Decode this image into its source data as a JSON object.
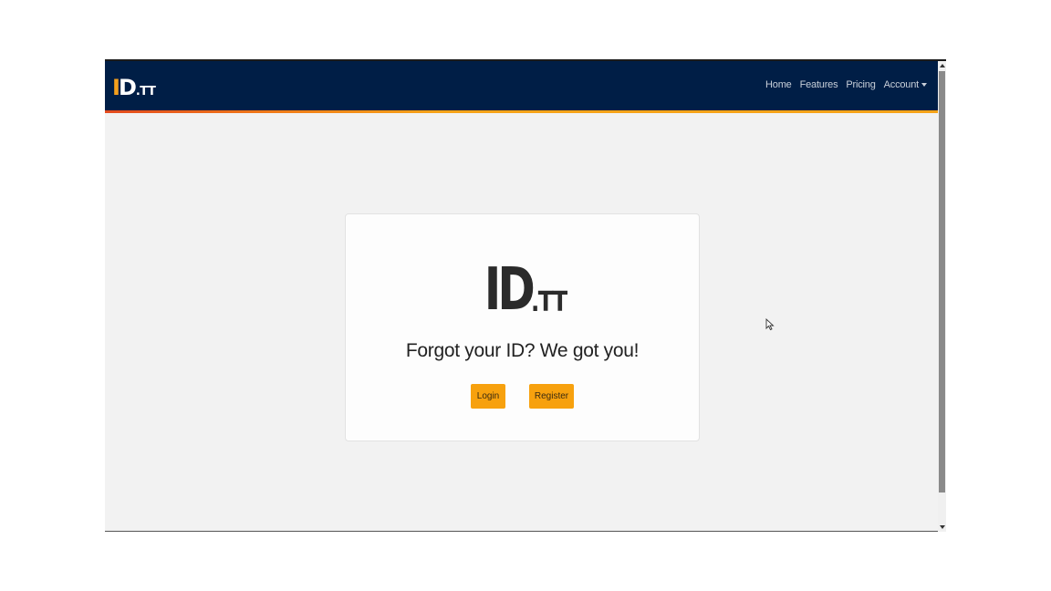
{
  "brand": {
    "logo_i": "I",
    "logo_d": "D",
    "logo_suffix": ".TT"
  },
  "nav": {
    "items": [
      {
        "label": "Home"
      },
      {
        "label": "Features"
      },
      {
        "label": "Pricing"
      },
      {
        "label": "Account",
        "has_dropdown": true
      }
    ]
  },
  "hero": {
    "logo_main": "ID",
    "logo_suffix": ".TT",
    "tagline": "Forgot your ID? We got you!",
    "login_label": "Login",
    "register_label": "Register"
  },
  "colors": {
    "navbar": "#001e46",
    "accent": "#f7a10e",
    "accent_stripe_start": "#e34a1e",
    "page_bg": "#f2f2f2",
    "card_bg": "#fdfdfd"
  },
  "icons": {
    "dropdown": "caret-down-icon",
    "cursor": "mouse-pointer-icon",
    "scroll_up": "scroll-up-arrow-icon",
    "scroll_down": "scroll-down-arrow-icon"
  }
}
